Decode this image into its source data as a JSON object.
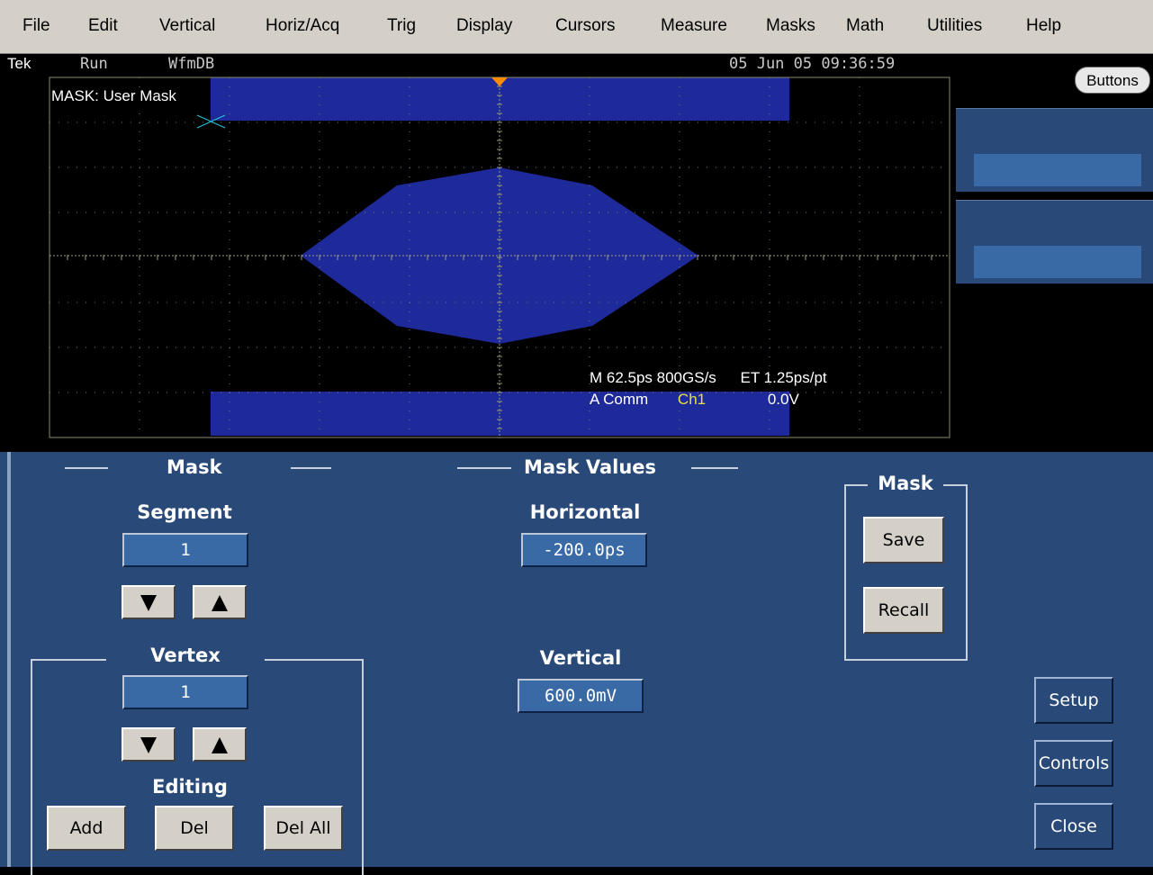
{
  "menu": {
    "items": [
      "File",
      "Edit",
      "Vertical",
      "Horiz/Acq",
      "Trig",
      "Display",
      "Cursors",
      "Measure",
      "Masks",
      "Math",
      "Utilities",
      "Help"
    ]
  },
  "status": {
    "tek": "Tek",
    "run": "Run",
    "mode": "WfmDB",
    "datetime": "05 Jun 05 09:36:59"
  },
  "scope": {
    "mask_label": "MASK: User Mask",
    "readout_line1_a": "M 62.5ps 800GS/s",
    "readout_line1_b": "ET 1.25ps/pt",
    "readout_line2_a": "A  Comm",
    "readout_line2_ch": "Ch1",
    "readout_line2_b": "0.0V"
  },
  "right_panel": {
    "buttons_label": "Buttons"
  },
  "controls": {
    "mask_section": "Mask",
    "segment_label": "Segment",
    "segment_value": "1",
    "vertex_label": "Vertex",
    "vertex_value": "1",
    "editing_label": "Editing",
    "add_label": "Add",
    "del_label": "Del",
    "del_all_label": "Del All",
    "mask_values_section": "Mask Values",
    "horizontal_label": "Horizontal",
    "horizontal_value": "-200.0ps",
    "vertical_label": "Vertical",
    "vertical_value": "600.0mV",
    "mask_group_title": "Mask",
    "save_label": "Save",
    "recall_label": "Recall",
    "setup_label": "Setup",
    "controls_label": "Controls",
    "close_label": "Close"
  },
  "colors": {
    "mask_fill": "#1f2a9a",
    "panel_bg": "#294978",
    "field_bg": "#3a6aa6",
    "graticule": "#8a8a6a",
    "trigger_marker": "#ff8c00",
    "channel_yellow": "#e8e040"
  }
}
